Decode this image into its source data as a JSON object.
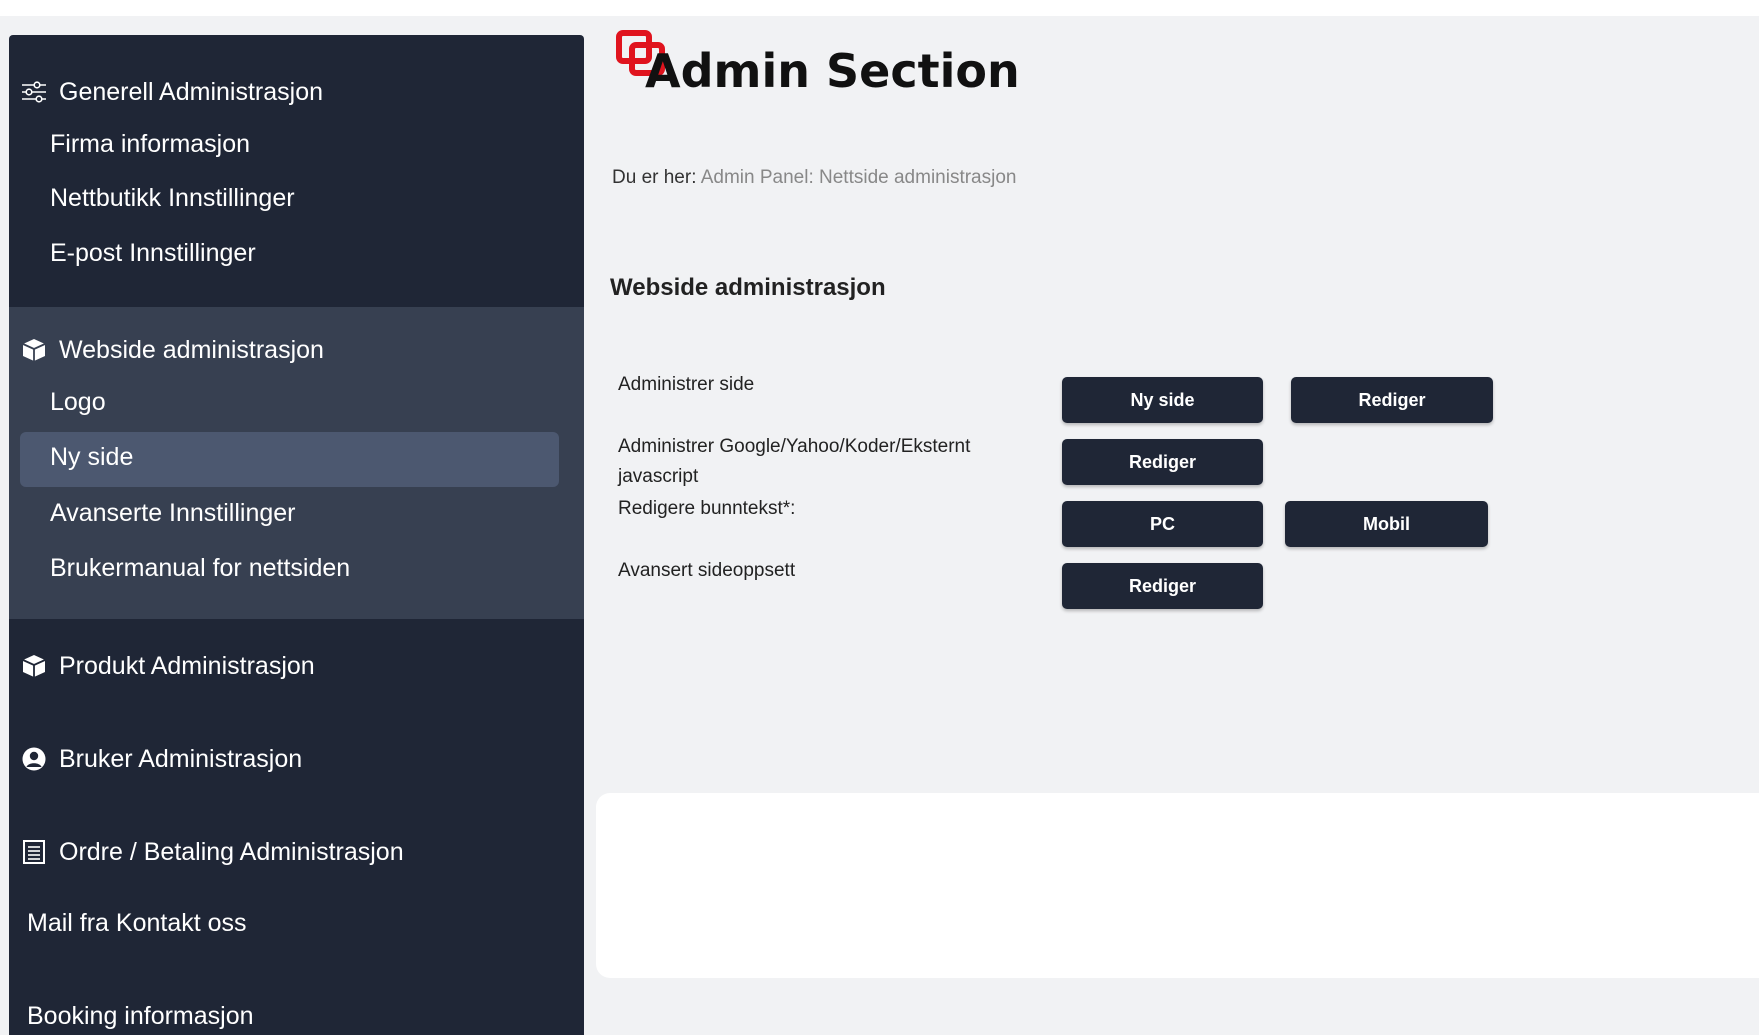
{
  "sidebar": {
    "general": {
      "title": "Generell Administrasjon",
      "icon": "sliders-icon",
      "items": [
        "Firma informasjon",
        "Nettbutikk Innstillinger",
        "E-post Innstillinger"
      ]
    },
    "website": {
      "title": "Webside administrasjon",
      "icon": "box-icon",
      "items": [
        "Logo",
        "Ny side",
        "Avanserte Innstillinger",
        "Brukermanual for nettsiden"
      ],
      "active_item": "Ny side"
    },
    "product": {
      "title": "Produkt Administrasjon",
      "icon": "box-icon"
    },
    "user": {
      "title": "Bruker Administrasjon",
      "icon": "user-circle-icon"
    },
    "order": {
      "title": "Ordre / Betaling Administrasjon",
      "icon": "receipt-icon"
    },
    "mail": "Mail fra Kontakt oss",
    "booking": "Booking informasjon"
  },
  "header": {
    "title": "Admin Section",
    "logo_color": "#e0141e"
  },
  "breadcrumb": {
    "prefix": "Du er her:",
    "trail": "Admin Panel: Nettside administrasjon"
  },
  "main": {
    "heading": "Webside administrasjon",
    "rows": [
      {
        "label": "Administrer side",
        "buttons": [
          "Ny side",
          "Rediger"
        ]
      },
      {
        "label": "Administrer Google/Yahoo/Koder/Eksternt javascript",
        "buttons": [
          "Rediger"
        ]
      },
      {
        "label": "Redigere bunntekst*:",
        "buttons": [
          "PC",
          "Mobil"
        ]
      },
      {
        "label": "Avansert sideoppsett",
        "buttons": [
          "Rediger"
        ]
      }
    ]
  },
  "colors": {
    "sidebar_bg": "#1f2636",
    "sidebar_active_section": "#374051",
    "sidebar_active_item": "#4c5870",
    "button_bg": "#1f2636",
    "page_bg": "#f1f2f4"
  }
}
